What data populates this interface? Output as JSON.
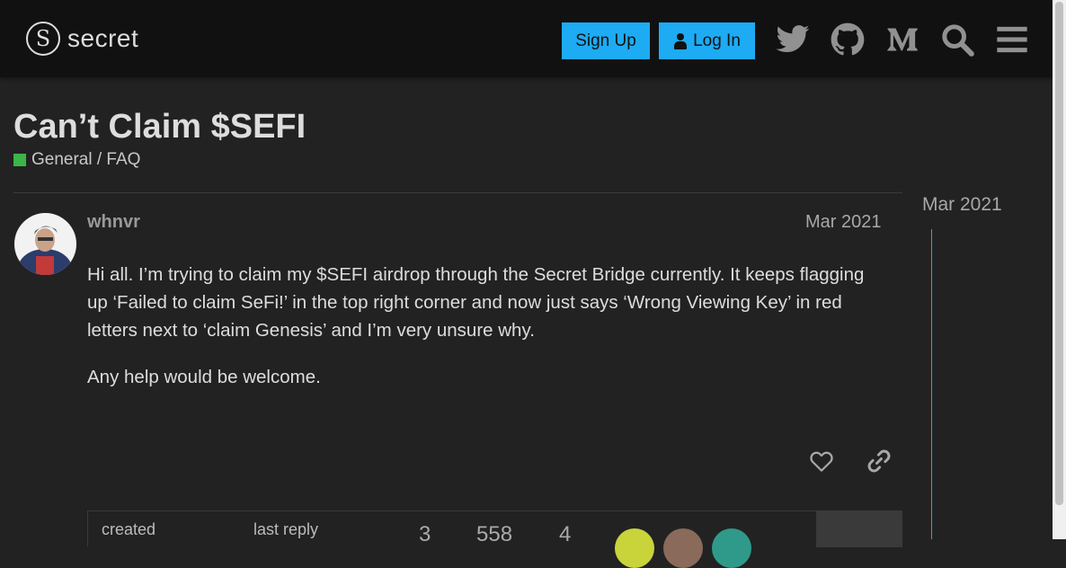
{
  "header": {
    "logo_text": "secret",
    "signup_label": "Sign Up",
    "login_label": "Log In",
    "icons": [
      "twitter-icon",
      "github-icon",
      "medium-icon",
      "search-icon",
      "hamburger-menu-icon"
    ]
  },
  "topic": {
    "title": "Can’t Claim $SEFI",
    "category": "General / FAQ",
    "category_color": "#3ab54a"
  },
  "post": {
    "username": "whnvr",
    "date": "Mar 2021",
    "paragraphs": [
      "Hi all. I’m trying to claim my $SEFI airdrop through the Secret Bridge currently. It keeps flagging up ‘Failed to claim SeFi!’ in the top right corner and now just says ‘Wrong Viewing Key’ in red letters next to ‘claim Genesis’ and I’m very unsure why.",
      "Any help would be welcome."
    ]
  },
  "summary": {
    "created_label": "created",
    "last_reply_label": "last reply",
    "replies": "3",
    "views": "558",
    "users": "4"
  },
  "timeline": {
    "date": "Mar 2021"
  },
  "colors": {
    "accent": "#1dabf3",
    "background": "#222222",
    "header": "#111111"
  }
}
